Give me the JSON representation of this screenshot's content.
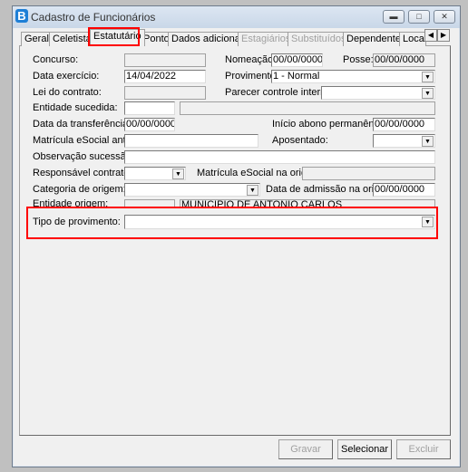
{
  "window": {
    "title": "Cadastro de Funcionários",
    "logo": "B"
  },
  "tabs": [
    {
      "label": "Geral",
      "enabled": true
    },
    {
      "label": "Celetista",
      "enabled": true
    },
    {
      "label": "Estatutário",
      "enabled": true,
      "active": true
    },
    {
      "label": "Ponto",
      "enabled": true
    },
    {
      "label": "Dados adicionais",
      "enabled": true
    },
    {
      "label": "Estagiários",
      "enabled": false
    },
    {
      "label": "Substituídos",
      "enabled": false
    },
    {
      "label": "Dependentes",
      "enabled": true
    },
    {
      "label": "Locai",
      "enabled": true
    }
  ],
  "form": {
    "concurso": {
      "label": "Concurso:",
      "value": ""
    },
    "nomeacao": {
      "label": "Nomeação:",
      "value": "00/00/0000"
    },
    "posse": {
      "label": "Posse:",
      "value": "00/00/0000"
    },
    "data_exercicio": {
      "label": "Data exercício:",
      "value": "14/04/2022"
    },
    "provimento": {
      "label": "Provimento:",
      "value": "1 - Normal"
    },
    "lei_contrato": {
      "label": "Lei do contrato:",
      "value": ""
    },
    "parecer": {
      "label": "Parecer controle interno:",
      "value": ""
    },
    "entidade_sucedida": {
      "label": "Entidade sucedida:",
      "code": "",
      "name": ""
    },
    "data_transferencia": {
      "label": "Data da transferência:",
      "value": "00/00/0000"
    },
    "inicio_abono": {
      "label": "Início abono permanência:",
      "value": "00/00/0000"
    },
    "matricula_ant": {
      "label": "Matrícula eSocial ant.:",
      "value": ""
    },
    "aposentado": {
      "label": "Aposentado:",
      "value": ""
    },
    "observacao": {
      "label": "Observação sucessão:",
      "value": ""
    },
    "responsavel": {
      "label": "Responsável contrato:",
      "value": ""
    },
    "matricula_origem": {
      "label": "Matrícula eSocial na origem:",
      "value": ""
    },
    "categoria_origem": {
      "label": "Categoria de origem:",
      "value": ""
    },
    "data_admissao_origem": {
      "label": "Data de admissão na origem:",
      "value": "00/00/0000"
    },
    "entidade_origem": {
      "label": "Entidade origem:",
      "code": "",
      "name": "MUNICIPIO DE ANTONIO CARLOS"
    },
    "tipo_provimento": {
      "label": "Tipo de provimento:",
      "value": ""
    }
  },
  "buttons": {
    "gravar": "Gravar",
    "selecionar": "Selecionar",
    "excluir": "Excluir"
  },
  "colors": {
    "highlight": "#ff0000"
  }
}
